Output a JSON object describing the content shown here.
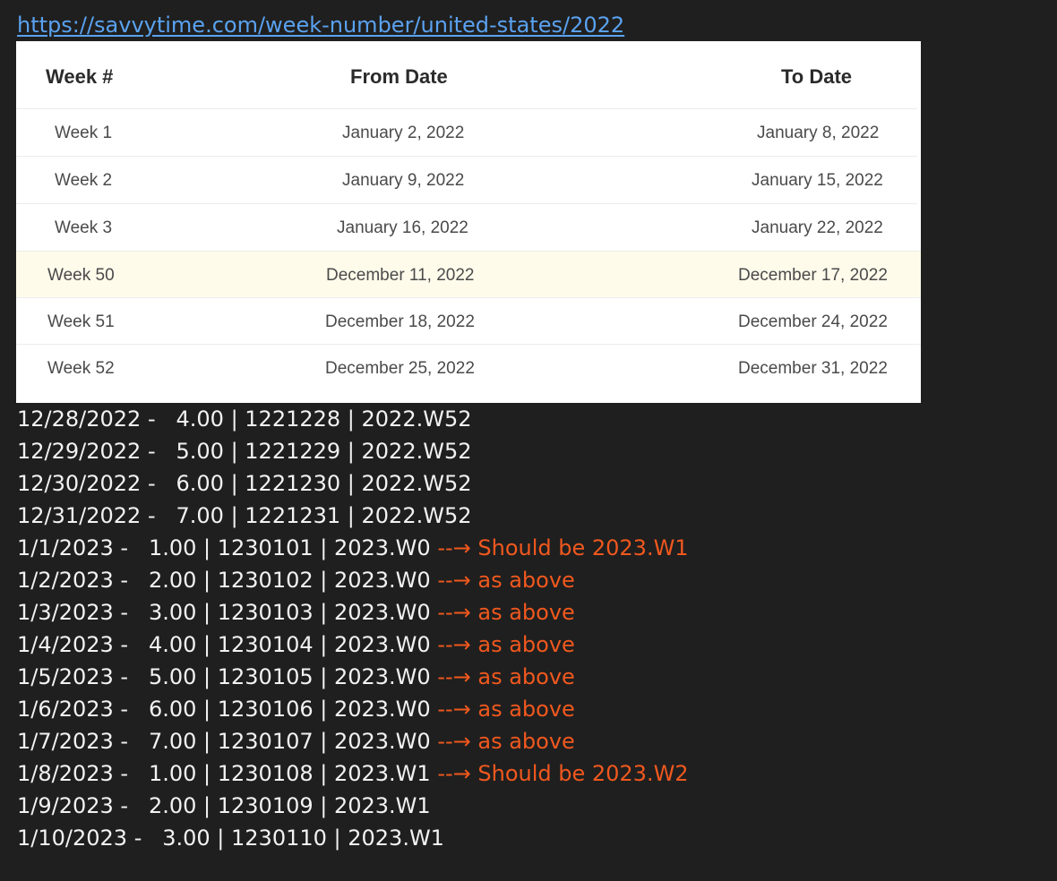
{
  "link": "https://savvytime.com/week-number/united-states/2022",
  "table": {
    "headers": [
      "Week #",
      "From Date",
      "To Date"
    ],
    "rows": [
      {
        "week": "Week 1",
        "from": "January 2, 2022",
        "to": "January 8, 2022"
      },
      {
        "week": "Week 2",
        "from": "January 9, 2022",
        "to": "January 15, 2022"
      },
      {
        "week": "Week 3",
        "from": "January 16, 2022",
        "to": "January 22, 2022"
      },
      {
        "week": "Week 50",
        "from": "December 11, 2022",
        "to": "December 17, 2022"
      },
      {
        "week": "Week 51",
        "from": "December 18, 2022",
        "to": "December 24, 2022"
      },
      {
        "week": "Week 52",
        "from": "December 25, 2022",
        "to": "December 31, 2022"
      }
    ],
    "highlight_color": "#fefbeb"
  },
  "log": [
    {
      "text": "12/28/2022 -   4.00 | 1221228 | 2022.W52",
      "note": ""
    },
    {
      "text": "12/29/2022 -   5.00 | 1221229 | 2022.W52",
      "note": ""
    },
    {
      "text": "12/30/2022 -   6.00 | 1221230 | 2022.W52",
      "note": ""
    },
    {
      "text": "12/31/2022 -   7.00 | 1221231 | 2022.W52",
      "note": ""
    },
    {
      "text": "1/1/2023 -   1.00 | 1230101 | 2023.W0 ",
      "note": "--→ Should be 2023.W1"
    },
    {
      "text": "1/2/2023 -   2.00 | 1230102 | 2023.W0 ",
      "note": "--→ as above"
    },
    {
      "text": "1/3/2023 -   3.00 | 1230103 | 2023.W0 ",
      "note": "--→ as above"
    },
    {
      "text": "1/4/2023 -   4.00 | 1230104 | 2023.W0 ",
      "note": "--→ as above"
    },
    {
      "text": "1/5/2023 -   5.00 | 1230105 | 2023.W0 ",
      "note": "--→ as above"
    },
    {
      "text": "1/6/2023 -   6.00 | 1230106 | 2023.W0 ",
      "note": "--→ as above"
    },
    {
      "text": "1/7/2023 -   7.00 | 1230107 | 2023.W0 ",
      "note": "--→ as above"
    },
    {
      "text": "1/8/2023 -   1.00 | 1230108 | 2023.W1 ",
      "note": "--→ Should be 2023.W2"
    },
    {
      "text": "1/9/2023 -   2.00 | 1230109 | 2023.W1",
      "note": ""
    },
    {
      "text": "1/10/2023 -   3.00 | 1230110 | 2023.W1",
      "note": ""
    }
  ],
  "colors": {
    "background": "#1f1f1f",
    "link": "#5aa2f0",
    "note": "#f0581e",
    "text": "#f2f2f2"
  }
}
